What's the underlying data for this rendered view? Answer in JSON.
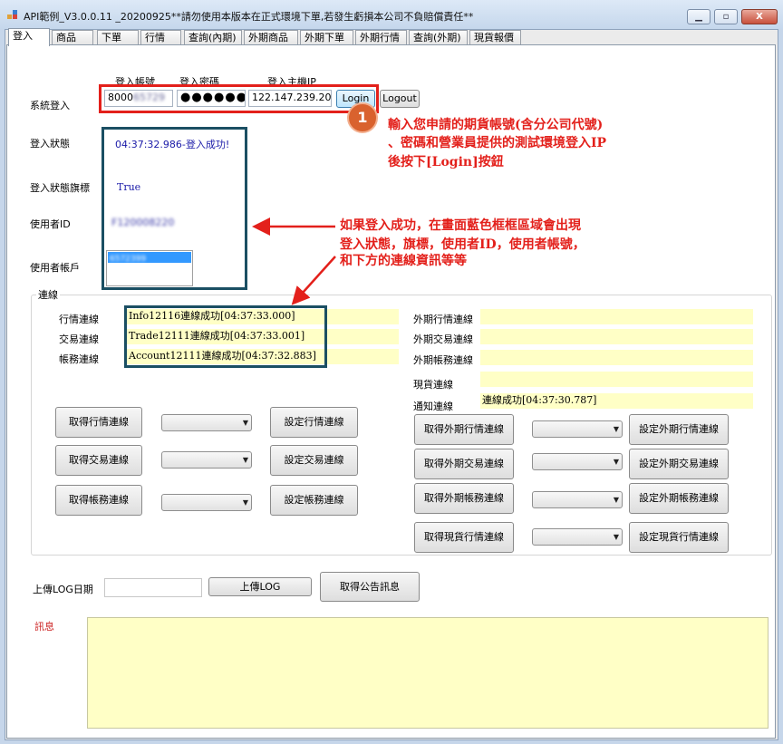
{
  "window": {
    "title": "API範例_V3.0.0.11 _20200925**請勿使用本版本在正式環境下單,若發生虧損本公司不負賠償責任**",
    "controls": [
      "▁",
      "▫",
      "X"
    ]
  },
  "tabs": [
    "登入",
    "商品",
    "下單",
    "行情",
    "查詢(內期)",
    "外期商品",
    "外期下單",
    "外期行情",
    "查詢(外期)",
    "現貨報價"
  ],
  "login": {
    "system_label": "系統登入",
    "account_header": "登入帳號",
    "password_header": "登入密碼",
    "host_header": "登入主機IP",
    "account_value": "8000",
    "account_blurred": "65729",
    "password_value": "●●●●●●",
    "host_value": "122.147.239.209",
    "login_button": "Login",
    "logout_button": "Logout"
  },
  "status": {
    "state_label": "登入狀態",
    "state_value": "04:37:32.986-登入成功!",
    "flag_label": "登入狀態旗標",
    "flag_value": "True",
    "userid_label": "使用者ID",
    "userid_value": "F120008220",
    "account_label": "使用者帳戶",
    "account_value": "6572399"
  },
  "connection": {
    "group_title": "連線",
    "quote_label": "行情連線",
    "quote_value": "Info12116連線成功[04:37:33.000]",
    "trade_label": "交易連線",
    "trade_value": "Trade12111連線成功[04:37:33.001]",
    "account_label": "帳務連線",
    "account_value": "Account12111連線成功[04:37:32.883]",
    "f_quote_label": "外期行情連線",
    "f_trade_label": "外期交易連線",
    "f_account_label": "外期帳務連線",
    "spot_label": "現貨連線",
    "notify_label": "通知連線",
    "notify_value": "連線成功[04:37:30.787]",
    "btn_get_quote": "取得行情連線",
    "btn_set_quote": "設定行情連線",
    "btn_get_trade": "取得交易連線",
    "btn_set_trade": "設定交易連線",
    "btn_get_account": "取得帳務連線",
    "btn_set_account": "設定帳務連線",
    "btn_get_f_quote": "取得外期行情連線",
    "btn_set_f_quote": "設定外期行情連線",
    "btn_get_f_trade": "取得外期交易連線",
    "btn_set_f_trade": "設定外期交易連線",
    "btn_get_f_account": "取得外期帳務連線",
    "btn_set_f_account": "設定外期帳務連線",
    "btn_get_spot": "取得現貨行情連線",
    "btn_set_spot": "設定現貨行情連線"
  },
  "log": {
    "date_label": "上傳LOG日期",
    "upload_button": "上傳LOG",
    "notice_button": "取得公告訊息",
    "message_label": "訊息"
  },
  "annotations": {
    "step_number": "1",
    "step1_line1": "輸入您申請的期貨帳號(含分公司代號)",
    "step1_line2": "、密碼和營業員提供的測試環境登入IP",
    "step1_line3": "後按下[Login]按鈕",
    "result_line1": "如果登入成功，在畫面藍色框框區域會出現",
    "result_line2": "登入狀態，旗標，使用者ID，使用者帳號，",
    "result_line3": "和下方的連線資訊等等"
  },
  "colors": {
    "annotation_red": "#e3201b",
    "highlight_teal": "#1b4f63",
    "field_yellow": "#ffffc6",
    "status_blue": "#1a1aa8",
    "badge_orange": "#d9622e"
  }
}
